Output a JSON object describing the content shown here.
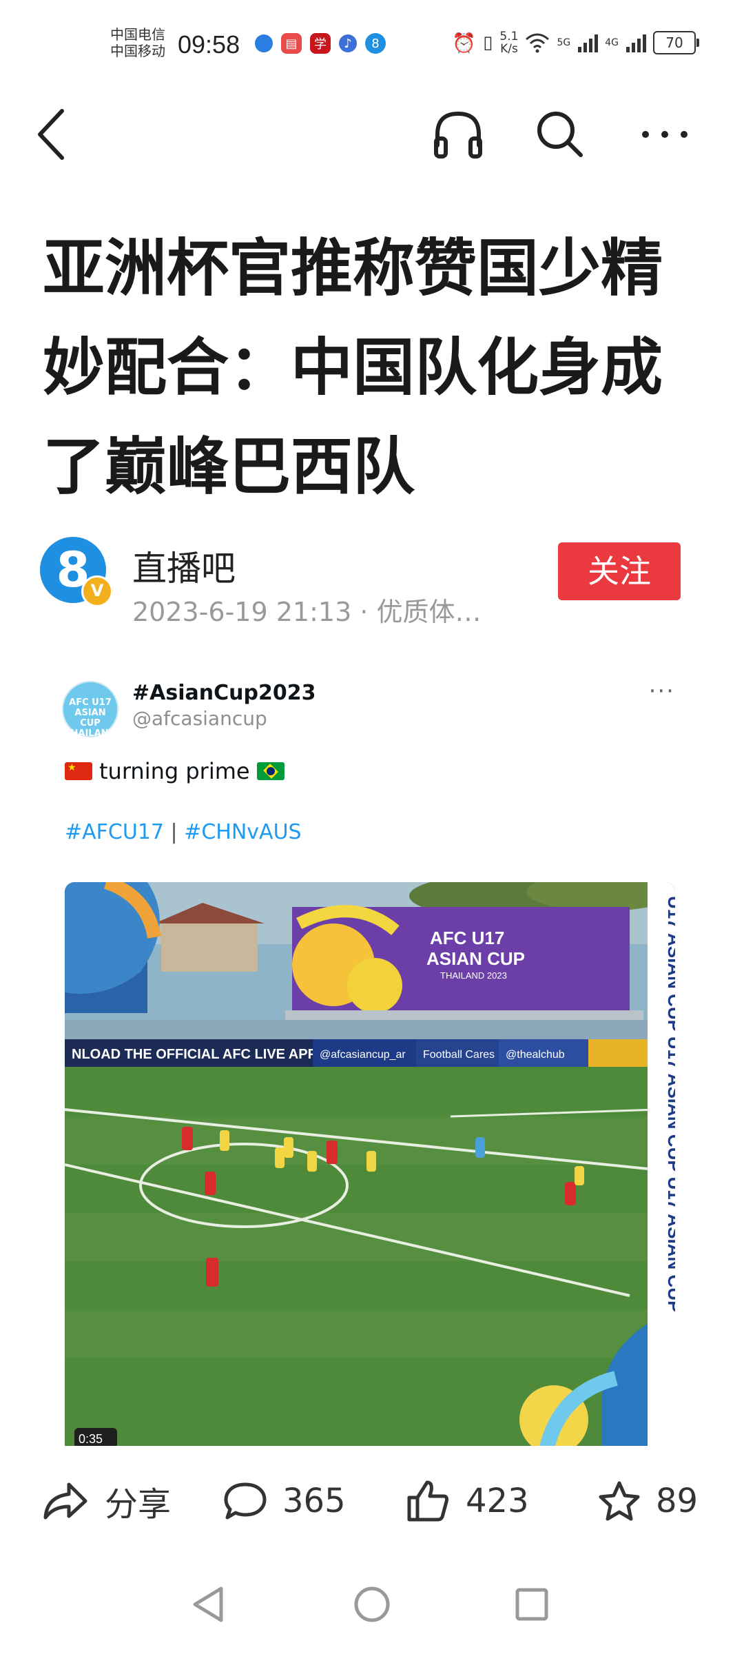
{
  "status_bar": {
    "carrier_1": "中国电信",
    "carrier_2": "中国移动",
    "time": "09:58",
    "net_speed_value": "5.1",
    "net_speed_unit": "K/s",
    "signal_1": "5G",
    "signal_2": "4G",
    "battery": "70"
  },
  "nav": {
    "back_icon": "chevron-left-icon",
    "listen_icon": "headphones-icon",
    "search_icon": "search-icon",
    "more_icon": "more-horizontal-icon"
  },
  "article": {
    "title": "亚洲杯官推称赞国少精妙配合：中国队化身成了巅峰巴西队"
  },
  "author": {
    "avatar_text": "8",
    "verified_badge": "V",
    "name": "直播吧",
    "meta": "2023-6-19 21:13 · 优质体…",
    "follow_label": "关注"
  },
  "tweet": {
    "avatar_text": "AFC U17 ASIAN CUP THAILAND 2023",
    "display_name": "#AsianCup2023",
    "handle": "@afcasiancup",
    "more": "···",
    "text": "turning prime",
    "hashtag_1": "#AFCU17",
    "hashtag_sep": "|",
    "hashtag_2": "#CHNvAUS",
    "media": {
      "ad_board_text": "NLOAD THE OFFICIAL AFC LIVE APP",
      "twitter_board": "@afcasiancup_ar",
      "football_cares": "Football Cares",
      "thealchub": "@thealchub",
      "billboard_line1": "AFC U17",
      "billboard_line2": "ASIAN CUP",
      "billboard_line3": "THAILAND 2023",
      "side_text": "U17 ASIAN CUP U17 ASIAN CUP U17 ASIAN CUP",
      "timer": "0:35"
    }
  },
  "actions": {
    "share_label": "分享",
    "comments_count": "365",
    "likes_count": "423",
    "favorites_count": "89"
  },
  "colors": {
    "follow_button": "#ea3a3f",
    "hashtag": "#1d9bf0",
    "pitch": "#4e8a3a"
  }
}
